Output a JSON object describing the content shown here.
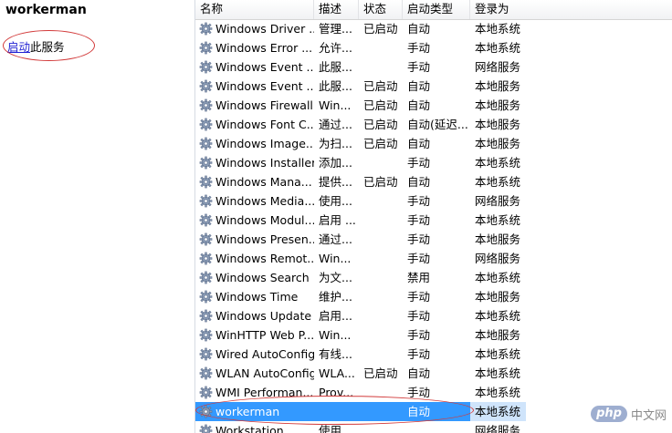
{
  "left_pane": {
    "service_name": "workerman",
    "action_link": "启动",
    "action_suffix": "此服务"
  },
  "columns": {
    "name": "名称",
    "description": "描述",
    "status": "状态",
    "startup_type": "启动类型",
    "log_on_as": "登录为"
  },
  "rows": [
    {
      "name": "Windows Driver ...",
      "desc": "管理...",
      "status": "已启动",
      "start": "自动",
      "logon": "本地系统"
    },
    {
      "name": "Windows Error ...",
      "desc": "允许...",
      "status": "",
      "start": "手动",
      "logon": "本地系统"
    },
    {
      "name": "Windows Event ...",
      "desc": "此服...",
      "status": "",
      "start": "手动",
      "logon": "网络服务"
    },
    {
      "name": "Windows Event ...",
      "desc": "此服...",
      "status": "已启动",
      "start": "自动",
      "logon": "本地服务"
    },
    {
      "name": "Windows Firewall",
      "desc": "Win...",
      "status": "已启动",
      "start": "自动",
      "logon": "本地服务"
    },
    {
      "name": "Windows Font C...",
      "desc": "通过...",
      "status": "已启动",
      "start": "自动(延迟...",
      "logon": "本地服务"
    },
    {
      "name": "Windows Image...",
      "desc": "为扫...",
      "status": "已启动",
      "start": "自动",
      "logon": "本地服务"
    },
    {
      "name": "Windows Installer",
      "desc": "添加...",
      "status": "",
      "start": "手动",
      "logon": "本地系统"
    },
    {
      "name": "Windows Mana...",
      "desc": "提供...",
      "status": "已启动",
      "start": "自动",
      "logon": "本地系统"
    },
    {
      "name": "Windows Media...",
      "desc": "使用...",
      "status": "",
      "start": "手动",
      "logon": "网络服务"
    },
    {
      "name": "Windows Modul...",
      "desc": "启用 ...",
      "status": "",
      "start": "手动",
      "logon": "本地系统"
    },
    {
      "name": "Windows Presen...",
      "desc": "通过...",
      "status": "",
      "start": "手动",
      "logon": "本地服务"
    },
    {
      "name": "Windows Remot...",
      "desc": "Win...",
      "status": "",
      "start": "手动",
      "logon": "网络服务"
    },
    {
      "name": "Windows Search",
      "desc": "为文...",
      "status": "",
      "start": "禁用",
      "logon": "本地系统"
    },
    {
      "name": "Windows Time",
      "desc": "维护...",
      "status": "",
      "start": "手动",
      "logon": "本地服务"
    },
    {
      "name": "Windows Update",
      "desc": "启用...",
      "status": "",
      "start": "手动",
      "logon": "本地系统"
    },
    {
      "name": "WinHTTP Web P...",
      "desc": "Win...",
      "status": "",
      "start": "手动",
      "logon": "本地服务"
    },
    {
      "name": "Wired AutoConfig",
      "desc": "有线...",
      "status": "",
      "start": "手动",
      "logon": "本地系统"
    },
    {
      "name": "WLAN AutoConfig",
      "desc": "WLA...",
      "status": "已启动",
      "start": "自动",
      "logon": "本地系统"
    },
    {
      "name": "WMI Performan...",
      "desc": "Prov...",
      "status": "",
      "start": "手动",
      "logon": "本地系统"
    },
    {
      "name": "workerman",
      "desc": "",
      "status": "",
      "start": "自动",
      "logon": "本地系统",
      "selected": true
    },
    {
      "name": "Workstation",
      "desc": "使用...",
      "status": "",
      "start": "",
      "logon": "网络服务"
    }
  ],
  "icons": {
    "service": "gear-icon"
  },
  "watermark": {
    "logo": "php",
    "text": "中文网"
  },
  "colors": {
    "selection": "#3399ff",
    "annotation": "#d23a3a"
  }
}
